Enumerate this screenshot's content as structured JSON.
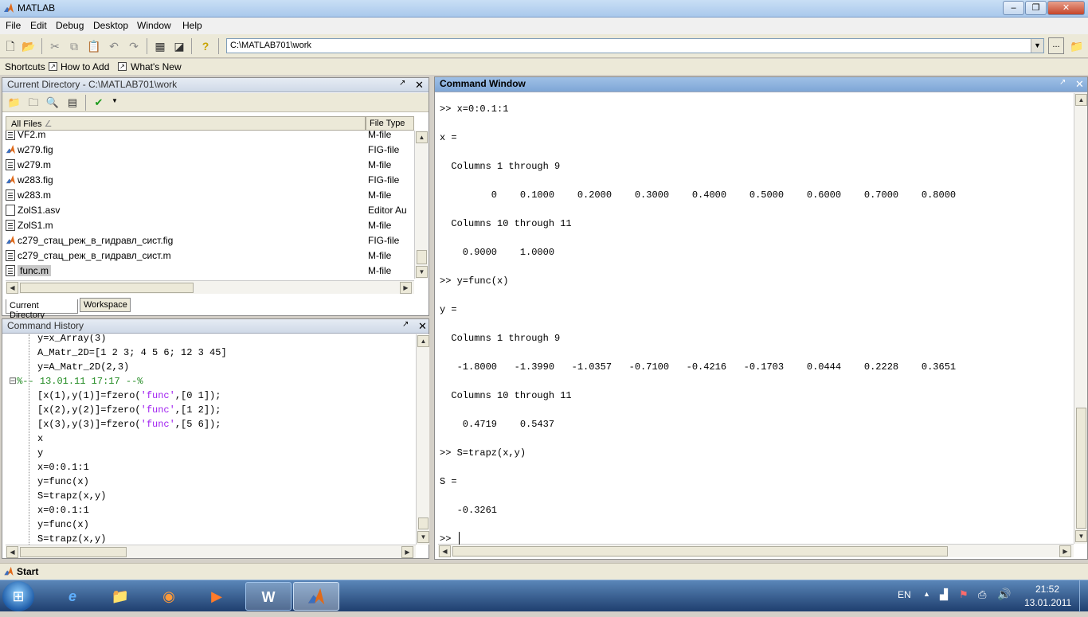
{
  "window": {
    "title": "MATLAB",
    "min": "‒",
    "max": "❐",
    "close": "✕"
  },
  "menu": [
    "File",
    "Edit",
    "Debug",
    "Desktop",
    "Window",
    "Help"
  ],
  "toolbar": {
    "current_directory": "C:\\MATLAB701\\work",
    "browse": "..."
  },
  "shortcuts": {
    "label": "Shortcuts",
    "items": [
      "How to Add",
      "What's New"
    ]
  },
  "current_directory": {
    "title": "Current Directory - C:\\MATLAB701\\work",
    "columns": [
      "All Files",
      "File Type"
    ],
    "files": [
      {
        "name": "VF2.m",
        "type": "M-file",
        "icon": "mfile"
      },
      {
        "name": "w279.fig",
        "type": "FIG-file",
        "icon": "fig"
      },
      {
        "name": "w279.m",
        "type": "M-file",
        "icon": "mfile"
      },
      {
        "name": "w283.fig",
        "type": "FIG-file",
        "icon": "fig"
      },
      {
        "name": "w283.m",
        "type": "M-file",
        "icon": "mfile"
      },
      {
        "name": "ZolS1.asv",
        "type": "Editor Au",
        "icon": "doc"
      },
      {
        "name": "ZolS1.m",
        "type": "M-file",
        "icon": "mfile"
      },
      {
        "name": "c279_стац_реж_в_гидравл_сист.fig",
        "type": "FIG-file",
        "icon": "fig"
      },
      {
        "name": "c279_стац_реж_в_гидравл_сист.m",
        "type": "M-file",
        "icon": "mfile"
      },
      {
        "name": "func.m",
        "type": "M-file",
        "icon": "mfile"
      }
    ],
    "tabs": [
      "Current Directory",
      "Workspace"
    ]
  },
  "command_history": {
    "title": "Command History",
    "lines": [
      {
        "text": "y=x_Array(3)",
        "kind": "cmd"
      },
      {
        "text": "A_Matr_2D=[1 2 3; 4 5 6; 12 3 45]",
        "kind": "cmd"
      },
      {
        "text": "y=A_Matr_2D(2,3)",
        "kind": "cmd"
      },
      {
        "text": "%-- 13.01.11 17:17 --%",
        "kind": "session"
      },
      {
        "pre": "[x(1),y(1)]=fzero(",
        "str": "'func'",
        "post": ",[0 1]);",
        "kind": "cmdstr"
      },
      {
        "pre": "[x(2),y(2)]=fzero(",
        "str": "'func'",
        "post": ",[1 2]);",
        "kind": "cmdstr"
      },
      {
        "pre": "[x(3),y(3)]=fzero(",
        "str": "'func'",
        "post": ",[5 6]);",
        "kind": "cmdstr"
      },
      {
        "text": "x",
        "kind": "cmd"
      },
      {
        "text": "y",
        "kind": "cmd"
      },
      {
        "text": "x=0:0.1:1",
        "kind": "cmd"
      },
      {
        "text": "y=func(x)",
        "kind": "cmd"
      },
      {
        "text": "S=trapz(x,y)",
        "kind": "cmd"
      },
      {
        "text": "x=0:0.1:1",
        "kind": "cmd"
      },
      {
        "text": "y=func(x)",
        "kind": "cmd"
      },
      {
        "text": "S=trapz(x,y)",
        "kind": "cmd"
      }
    ]
  },
  "command_window": {
    "title": "Command Window",
    "lines": [
      ">> x=0:0.1:1",
      "x =",
      "  Columns 1 through 9",
      "         0    0.1000    0.2000    0.3000    0.4000    0.5000    0.6000    0.7000    0.8000",
      "  Columns 10 through 11",
      "    0.9000    1.0000",
      ">> y=func(x)",
      "y =",
      "  Columns 1 through 9",
      "   -1.8000   -1.3990   -1.0357   -0.7100   -0.4216   -0.1703    0.0444    0.2228    0.3651",
      "  Columns 10 through 11",
      "    0.4719    0.5437",
      ">> S=trapz(x,y)",
      "S =",
      "   -0.3261",
      ">> "
    ]
  },
  "start_button": "Start",
  "taskbar": {
    "lang": "EN",
    "time": "21:52",
    "date": "13.01.2011"
  },
  "colors": {
    "string": "#a020f0",
    "session": "#228b22",
    "active_header": "#7ea6d6"
  }
}
